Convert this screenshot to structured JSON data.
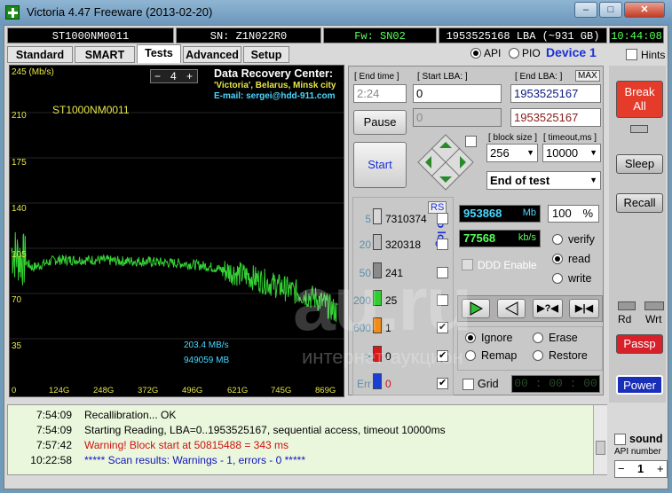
{
  "window": {
    "title": "Victoria 4.47  Freeware (2013-02-20)"
  },
  "info": {
    "model": "ST1000NM0011",
    "serial": "SN: Z1N022R0",
    "firmware": "Fw: SN02",
    "lba": "1953525168 LBA (~931 GB)",
    "clock": "10:44:08"
  },
  "mode": {
    "api": "API",
    "pio": "PIO",
    "device": "Device 1",
    "hints": "Hints"
  },
  "tabs": [
    "Standard",
    "SMART",
    "Tests",
    "Advanced",
    "Setup"
  ],
  "graph": {
    "unit": "245 (Mb/s)",
    "model": "ST1000NM0011",
    "step_value": "4",
    "step_minus": "−",
    "step_plus": "+",
    "dr_title": "Data Recovery Center:",
    "dr_line1": "'Victoria', Belarus, Minsk city",
    "dr_line2": "E-mail: sergei@hdd-911.com",
    "speed": "203.4 MB/s",
    "position": "949059 MB",
    "yticks": [
      "210",
      "175",
      "140",
      "105",
      "70",
      "35"
    ],
    "xticks": [
      "0",
      "124G",
      "248G",
      "372G",
      "496G",
      "621G",
      "745G",
      "869G"
    ]
  },
  "chart_data": {
    "type": "line",
    "x": [
      0,
      60,
      124,
      180,
      248,
      310,
      372,
      430,
      496,
      560,
      621,
      680,
      745,
      800,
      869,
      930
    ],
    "y": [
      103,
      90,
      96,
      96,
      96,
      95,
      95,
      94,
      93,
      91,
      87,
      83,
      77,
      72,
      66,
      55
    ],
    "xlabel": "",
    "ylabel": "245 (Mb/s)",
    "ylim": [
      0,
      245
    ],
    "xticks": [
      "0",
      "124G",
      "248G",
      "372G",
      "496G",
      "621G",
      "745G",
      "869G"
    ]
  },
  "controls": {
    "end_time_label": "[ End time ]",
    "end_time_value": "2:24",
    "start_lba_label": "[ Start LBA: ]",
    "start_lba_value": "0",
    "start_lba_value2": "0",
    "end_lba_label": "[ End LBA: ]",
    "max_label": "MAX",
    "end_lba_value": "1953525167",
    "end_lba_value2": "1953525167",
    "pause_label": "Pause",
    "start_label": "Start",
    "block_size_label": "[ block size ]",
    "block_size_value": "256",
    "timeout_label": "[ timeout,ms ]",
    "timeout_value": "10000",
    "end_of_test": "End of test",
    "rs_label": "RS",
    "to_log": "to log:"
  },
  "counters": [
    {
      "label": "5",
      "value": "7310374",
      "color": "#d8d8d8",
      "checked": false
    },
    {
      "label": "20",
      "value": "320318",
      "color": "#bdbdbd",
      "checked": false
    },
    {
      "label": "50",
      "value": "241",
      "color": "#8a8a8a",
      "checked": false
    },
    {
      "label": "200",
      "value": "25",
      "color": "#2fcf2f",
      "checked": false
    },
    {
      "label": "600",
      "value": "1",
      "color": "#f08c18",
      "checked": true
    },
    {
      "label": ">",
      "value": "0",
      "color": "#d81818",
      "checked": true
    },
    {
      "label": "Err",
      "value": "0",
      "color": "#1a3fd8",
      "checked": true
    }
  ],
  "stats": {
    "mb_value": "953868",
    "mb_unit": "Mb",
    "percent_value": "100",
    "percent_unit": "%",
    "kbs_value": "77568",
    "kbs_unit": "kb/s",
    "ddd": "DDD Enable",
    "verify": "verify",
    "read": "read",
    "write": "write",
    "ignore": "Ignore",
    "erase": "Erase",
    "remap": "Remap",
    "restore": "Restore",
    "grid": "Grid",
    "timer": "00 : 00 : 00"
  },
  "side": {
    "break_all": "Break\nAll",
    "sleep": "Sleep",
    "recall": "Recall",
    "rd": "Rd",
    "wrt": "Wrt",
    "passp": "Passp",
    "power": "Power",
    "sound": "sound",
    "api_number": "API number",
    "api_value": "1",
    "minus": "−",
    "plus": "+"
  },
  "log": [
    {
      "time": "7:54:09",
      "text": "Recallibration... OK",
      "color": "#000000"
    },
    {
      "time": "7:54:09",
      "text": "Starting Reading, LBA=0..1953525167, sequential access, timeout 10000ms",
      "color": "#000000"
    },
    {
      "time": "7:57:42",
      "text": "Warning! Block start at 50815488 = 343 ms",
      "color": "#d01010"
    },
    {
      "time": "10:22:58",
      "text": "***** Scan results: Warnings - 1, errors - 0 *****",
      "color": "#1010c0"
    }
  ],
  "watermark": {
    "big": "au.ru",
    "small": "интернет-аукцион"
  }
}
